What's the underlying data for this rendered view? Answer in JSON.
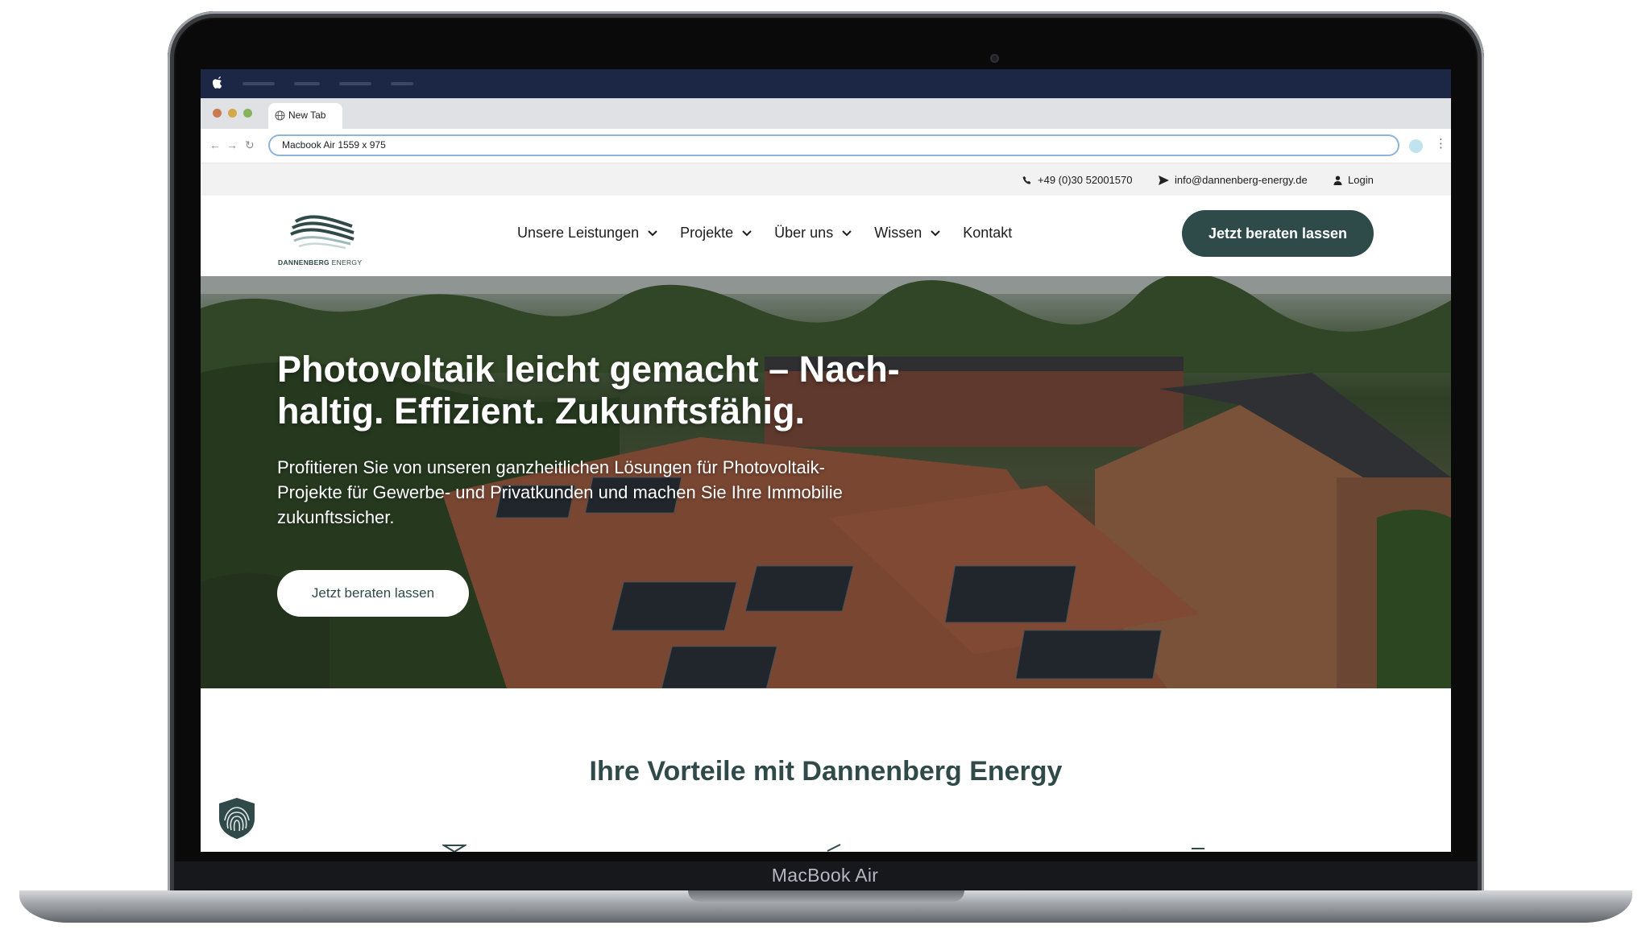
{
  "device": {
    "model_label": "MacBook Air"
  },
  "browser": {
    "tab_title": "New Tab",
    "url_text": "Macbook Air  1559 x 975"
  },
  "topbar": {
    "phone": "+49 (0)30 52001570",
    "email": "info@dannenberg-energy.de",
    "login": "Login"
  },
  "header": {
    "logo_text_bold": "DANNENBERG",
    "logo_text_light": "ENERGY",
    "nav": [
      {
        "label": "Unsere Leistungen"
      },
      {
        "label": "Projekte"
      },
      {
        "label": "Über uns"
      },
      {
        "label": "Wissen"
      },
      {
        "label": "Kontakt"
      }
    ],
    "cta_label": "Jetzt beraten lassen"
  },
  "hero": {
    "title": "Photovoltaik leicht gemacht – Nach-haltig. Effizient. Zukunftsfähig.",
    "text": "Profitieren Sie von unseren ganzheitlichen Lösungen für Photovoltaik-Projekte für Gewerbe- und Privatkunden und machen Sie Ihre Immobilie zukunftssicher.",
    "button_label": "Jetzt beraten lassen"
  },
  "benefits": {
    "title": "Ihre Vorteile mit Dannenberg Energy"
  },
  "colors": {
    "brand_green": "#2e4b49",
    "menubar": "#1c2745"
  }
}
